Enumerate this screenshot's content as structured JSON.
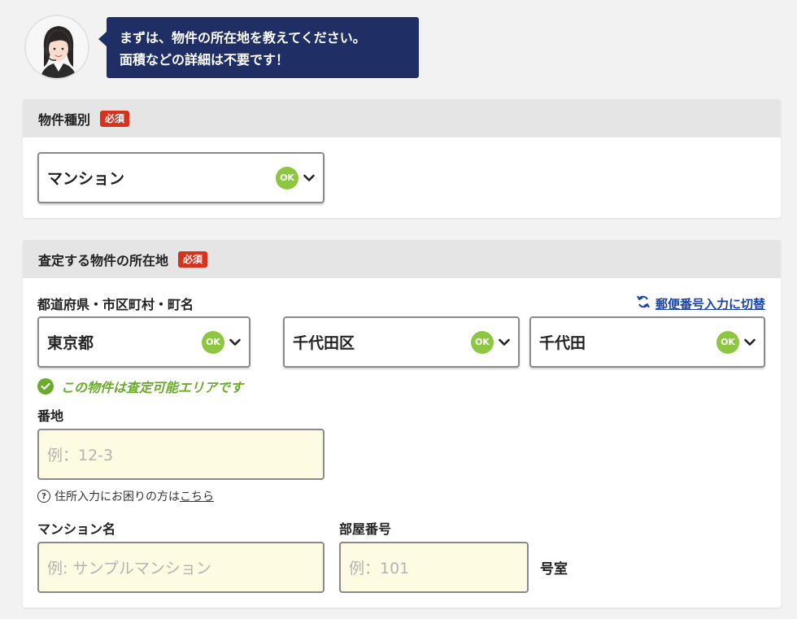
{
  "operator": {
    "message_line1": "まずは、物件の所在地を教えてください。",
    "message_line2": "面積などの詳細は不要です！"
  },
  "property_type": {
    "heading": "物件種別",
    "required_badge": "必須",
    "selected": "マンション",
    "ok_badge": "OK"
  },
  "location": {
    "heading": "査定する物件の所在地",
    "required_badge": "必須",
    "address_label": "都道府県・市区町村・町名",
    "switch_link": "郵便番号入力に切替",
    "prefecture": "東京都",
    "city": "千代田区",
    "town": "千代田",
    "ok_badge": "OK",
    "area_message": "この物件は査定可能エリアです",
    "banchi_label": "番地",
    "banchi_placeholder": "例：12-3",
    "help_text": "住所入力にお困りの方は",
    "help_link": "こちら",
    "mansion_name_label": "マンション名",
    "mansion_name_placeholder": "例: サンプルマンション",
    "room_label": "部屋番号",
    "room_placeholder": "例：101",
    "room_suffix": "号室"
  },
  "colors": {
    "bubble": "#1f2f66",
    "required": "#d6321e",
    "ok": "#8dc63f",
    "link": "#1a44a8",
    "input_bg": "#fefbe3"
  }
}
